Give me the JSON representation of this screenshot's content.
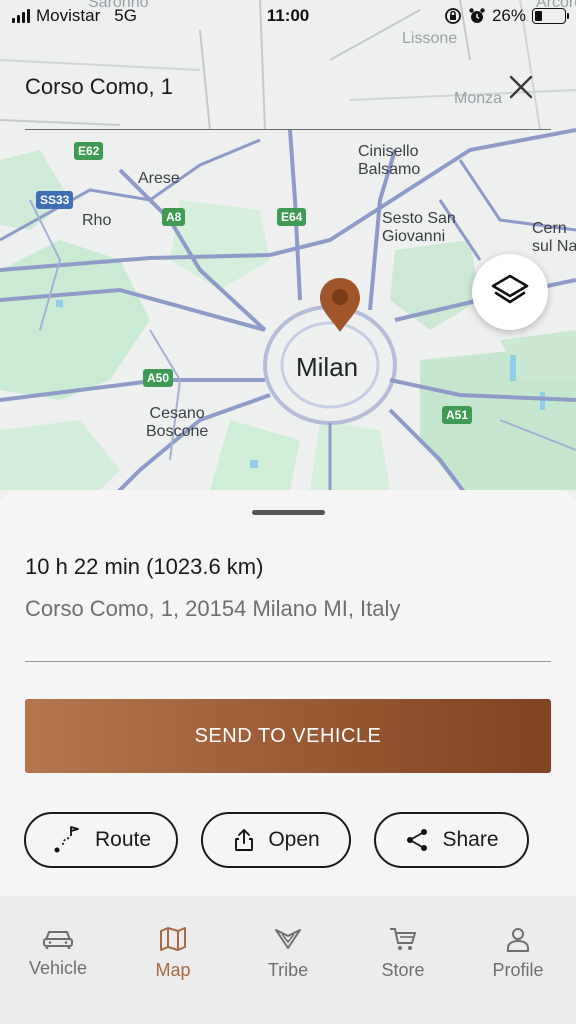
{
  "status_bar": {
    "carrier": "Movistar",
    "network": "5G",
    "time": "11:00",
    "battery_percent": "26%",
    "battery_level": 0.26
  },
  "search": {
    "title": "Corso Como, 1"
  },
  "map": {
    "places": {
      "saronno": "Saronno",
      "lissone": "Lissone",
      "monza": "Monza",
      "arese": "Arese",
      "rho": "Rho",
      "cinisello": "Cinisello\nBalsamo",
      "sesto": "Sesto San\nGiovanni",
      "cernusco": "Cern\nsul Na",
      "milan": "Milan",
      "cesano": "Cesano\nBoscone",
      "arcore": "Arcore"
    },
    "shields": {
      "e62": "E62",
      "ss33": "SS33",
      "a8": "A8",
      "e64": "E64",
      "a50": "A50",
      "a51": "A51"
    },
    "colors": {
      "land": "#eef0ef",
      "park": "#bfe6c9",
      "road": "#8e9bc9",
      "water": "#8fd0e8",
      "pin": "#a0562a"
    }
  },
  "sheet": {
    "duration": "10 h 22 min (1023.6 km)",
    "address": "Corso Como, 1, 20154 Milano MI, Italy",
    "send_label": "SEND TO VEHICLE",
    "actions": {
      "route": "Route",
      "open": "Open",
      "share": "Share"
    }
  },
  "tabs": [
    {
      "label": "Vehicle",
      "icon": "car-icon",
      "active": false
    },
    {
      "label": "Map",
      "icon": "map-icon",
      "active": true
    },
    {
      "label": "Tribe",
      "icon": "tribe-icon",
      "active": false
    },
    {
      "label": "Store",
      "icon": "cart-icon",
      "active": false
    },
    {
      "label": "Profile",
      "icon": "person-icon",
      "active": false
    }
  ],
  "theme": {
    "accent": "#a86a45",
    "button_gradient_start": "#b7774d",
    "button_gradient_end": "#7f4420"
  }
}
